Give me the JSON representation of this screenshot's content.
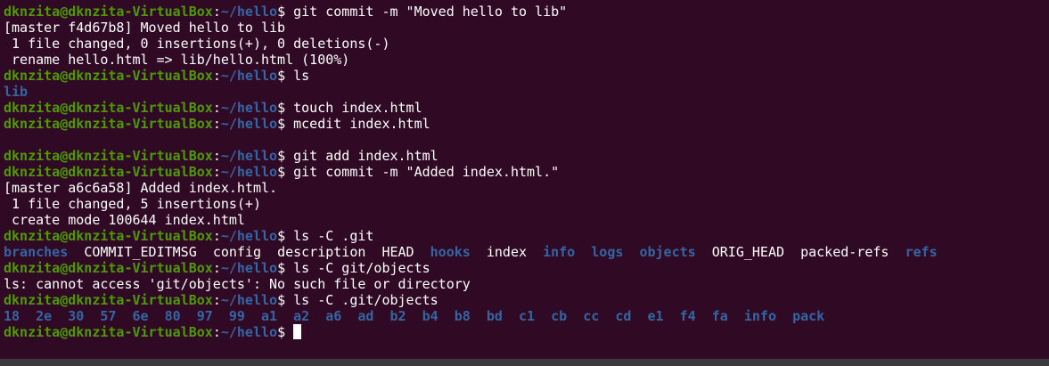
{
  "prompt": {
    "user_host": "dknzita@dknzita-VirtualBox",
    "colon": ":",
    "path": "~/hello",
    "symbol": "$ "
  },
  "colors": {
    "background": "#300a24",
    "user": "#4e9a06",
    "path": "#3465a4",
    "directory": "#3465a4",
    "text": "#ffffff"
  },
  "lines": [
    {
      "type": "cmd",
      "cmd": "git commit -m \"Moved hello to lib\""
    },
    {
      "type": "out",
      "text": "[master f4d67b8] Moved hello to lib"
    },
    {
      "type": "out",
      "text": " 1 file changed, 0 insertions(+), 0 deletions(-)"
    },
    {
      "type": "out",
      "text": " rename hello.html => lib/hello.html (100%)"
    },
    {
      "type": "cmd",
      "cmd": "ls"
    },
    {
      "type": "items",
      "items": [
        {
          "t": "lib",
          "dir": true
        }
      ]
    },
    {
      "type": "cmd",
      "cmd": "touch index.html"
    },
    {
      "type": "cmd",
      "cmd": "mcedit index.html"
    },
    {
      "type": "blank"
    },
    {
      "type": "cmd",
      "cmd": "git add index.html"
    },
    {
      "type": "cmd",
      "cmd": "git commit -m \"Added index.html.\""
    },
    {
      "type": "out",
      "text": "[master a6c6a58] Added index.html."
    },
    {
      "type": "out",
      "text": " 1 file changed, 5 insertions(+)"
    },
    {
      "type": "out",
      "text": " create mode 100644 index.html"
    },
    {
      "type": "cmd",
      "cmd": "ls -C .git"
    },
    {
      "type": "items",
      "items": [
        {
          "t": "branches",
          "dir": true
        },
        {
          "t": "COMMIT_EDITMSG",
          "dir": false
        },
        {
          "t": "config",
          "dir": false
        },
        {
          "t": "description",
          "dir": false
        },
        {
          "t": "HEAD",
          "dir": false
        },
        {
          "t": "hooks",
          "dir": true
        },
        {
          "t": "index",
          "dir": false
        },
        {
          "t": "info",
          "dir": true
        },
        {
          "t": "logs",
          "dir": true
        },
        {
          "t": "objects",
          "dir": true
        },
        {
          "t": "ORIG_HEAD",
          "dir": false
        },
        {
          "t": "packed-refs",
          "dir": false
        },
        {
          "t": "refs",
          "dir": true
        }
      ]
    },
    {
      "type": "cmd",
      "cmd": "ls -C git/objects"
    },
    {
      "type": "out",
      "text": "ls: cannot access 'git/objects': No such file or directory"
    },
    {
      "type": "cmd",
      "cmd": "ls -C .git/objects"
    },
    {
      "type": "items",
      "items": [
        {
          "t": "18",
          "dir": true
        },
        {
          "t": "2e",
          "dir": true
        },
        {
          "t": "30",
          "dir": true
        },
        {
          "t": "57",
          "dir": true
        },
        {
          "t": "6e",
          "dir": true
        },
        {
          "t": "80",
          "dir": true
        },
        {
          "t": "97",
          "dir": true
        },
        {
          "t": "99",
          "dir": true
        },
        {
          "t": "a1",
          "dir": true
        },
        {
          "t": "a2",
          "dir": true
        },
        {
          "t": "a6",
          "dir": true
        },
        {
          "t": "ad",
          "dir": true
        },
        {
          "t": "b2",
          "dir": true
        },
        {
          "t": "b4",
          "dir": true
        },
        {
          "t": "b8",
          "dir": true
        },
        {
          "t": "bd",
          "dir": true
        },
        {
          "t": "c1",
          "dir": true
        },
        {
          "t": "cb",
          "dir": true
        },
        {
          "t": "cc",
          "dir": true
        },
        {
          "t": "cd",
          "dir": true
        },
        {
          "t": "e1",
          "dir": true
        },
        {
          "t": "f4",
          "dir": true
        },
        {
          "t": "fa",
          "dir": true
        },
        {
          "t": "info",
          "dir": true
        },
        {
          "t": "pack",
          "dir": true
        }
      ]
    },
    {
      "type": "cmd",
      "cmd": "",
      "cursor": true
    }
  ]
}
